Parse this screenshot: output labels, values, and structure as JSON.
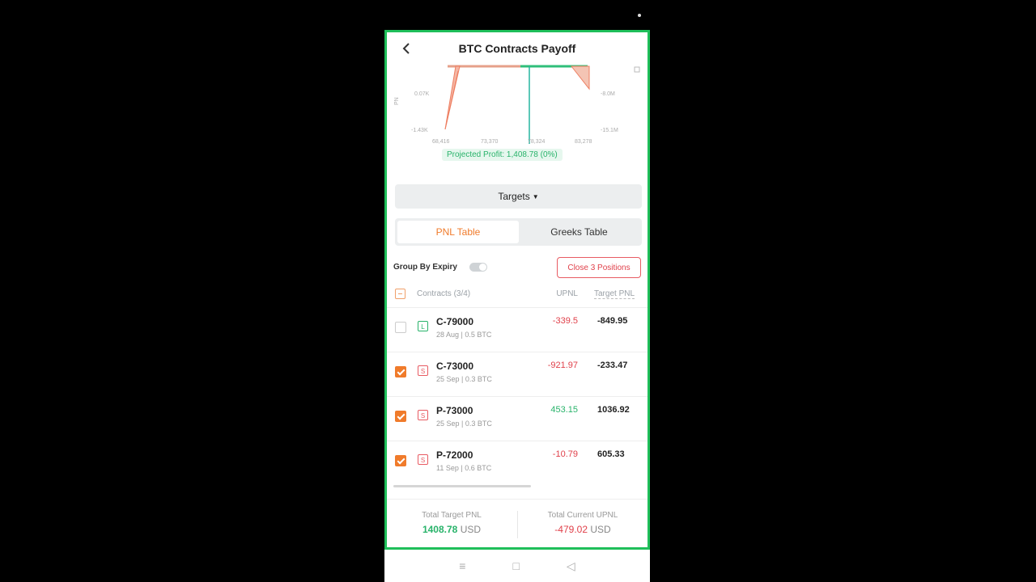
{
  "header": {
    "title": "BTC Contracts Payoff"
  },
  "chart": {
    "left_ticks": [
      "0.07K",
      "-1.43K"
    ],
    "right_ticks": [
      "-8.0M",
      "-15.1M"
    ],
    "x_ticks": [
      "68,416",
      "73,370",
      "78,324",
      "83,278"
    ],
    "projected_profit": "Projected Profit: 1,408.78 (0%)",
    "colors": {
      "loss": "#f08a6a",
      "profit": "#2fbf7a",
      "current": "#26b5a0"
    }
  },
  "targets": {
    "label": "Targets"
  },
  "tabs": [
    {
      "label": "PNL Table",
      "active": true
    },
    {
      "label": "Greeks Table",
      "active": false
    }
  ],
  "controls": {
    "group_label": "Group By Expiry",
    "close_label": "Close 3 Positions"
  },
  "table": {
    "headers": {
      "contracts": "Contracts (3/4)",
      "upnl": "UPNL",
      "target": "Target PNL"
    },
    "rows": [
      {
        "checked": false,
        "side": "L",
        "name": "C-79000",
        "sub": "28 Aug | 0.5 BTC",
        "upnl": "-339.5",
        "target": "-849.95"
      },
      {
        "checked": true,
        "side": "S",
        "name": "C-73000",
        "sub": "25 Sep | 0.3 BTC",
        "upnl": "-921.97",
        "target": "-233.47"
      },
      {
        "checked": true,
        "side": "S",
        "name": "P-73000",
        "sub": "25 Sep | 0.3 BTC",
        "upnl": "453.15",
        "target": "1036.92"
      },
      {
        "checked": true,
        "side": "S",
        "name": "P-72000",
        "sub": "11 Sep | 0.6 BTC",
        "upnl": "-10.79",
        "target": "605.33"
      }
    ]
  },
  "footer": {
    "target_label": "Total Target PNL",
    "target_value": "1408.78",
    "current_label": "Total Current UPNL",
    "current_value": "-479.02",
    "unit": "USD"
  },
  "system_nav": {
    "menu_icon": "≡",
    "home_icon": "□",
    "back_icon": "◁"
  }
}
